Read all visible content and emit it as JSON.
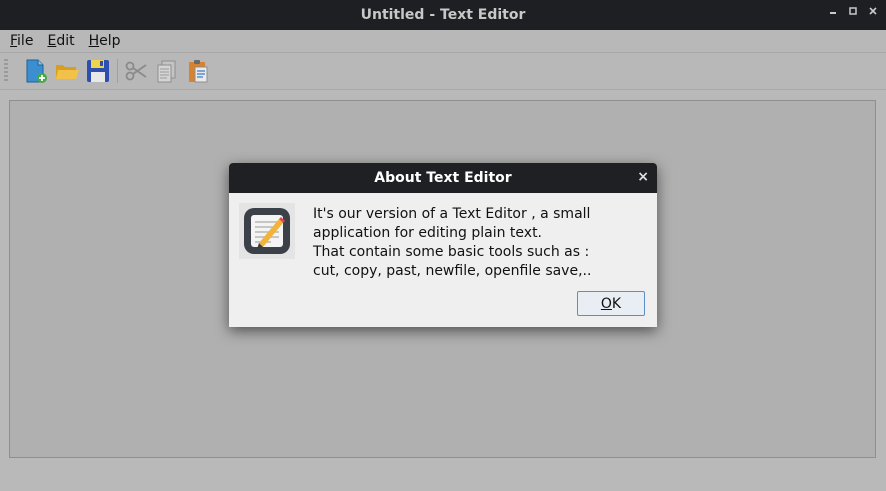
{
  "window": {
    "title": "Untitled - Text Editor",
    "controls": [
      "minimize",
      "maximize",
      "close"
    ]
  },
  "menubar": {
    "items": [
      {
        "label": "File"
      },
      {
        "label": "Edit"
      },
      {
        "label": "Help"
      }
    ]
  },
  "toolbar": {
    "icons": [
      "new-file-icon",
      "open-folder-icon",
      "save-icon",
      "cut-icon",
      "copy-icon",
      "paste-icon"
    ]
  },
  "dialog": {
    "title": "About Text Editor",
    "close_glyph": "×",
    "icon": "text-editor-app-icon",
    "lines": [
      "It's our version of a Text Editor , a small",
      "application for editing plain text.",
      "That contain some basic tools such as :",
      "cut, copy, past, newfile, openfile save,.."
    ],
    "ok_label": "OK"
  },
  "colors": {
    "titlebar": "#1e1f22",
    "app_background": "#b9b9b9",
    "dialog_background": "#efefef",
    "accent": "#5b8fc7"
  }
}
